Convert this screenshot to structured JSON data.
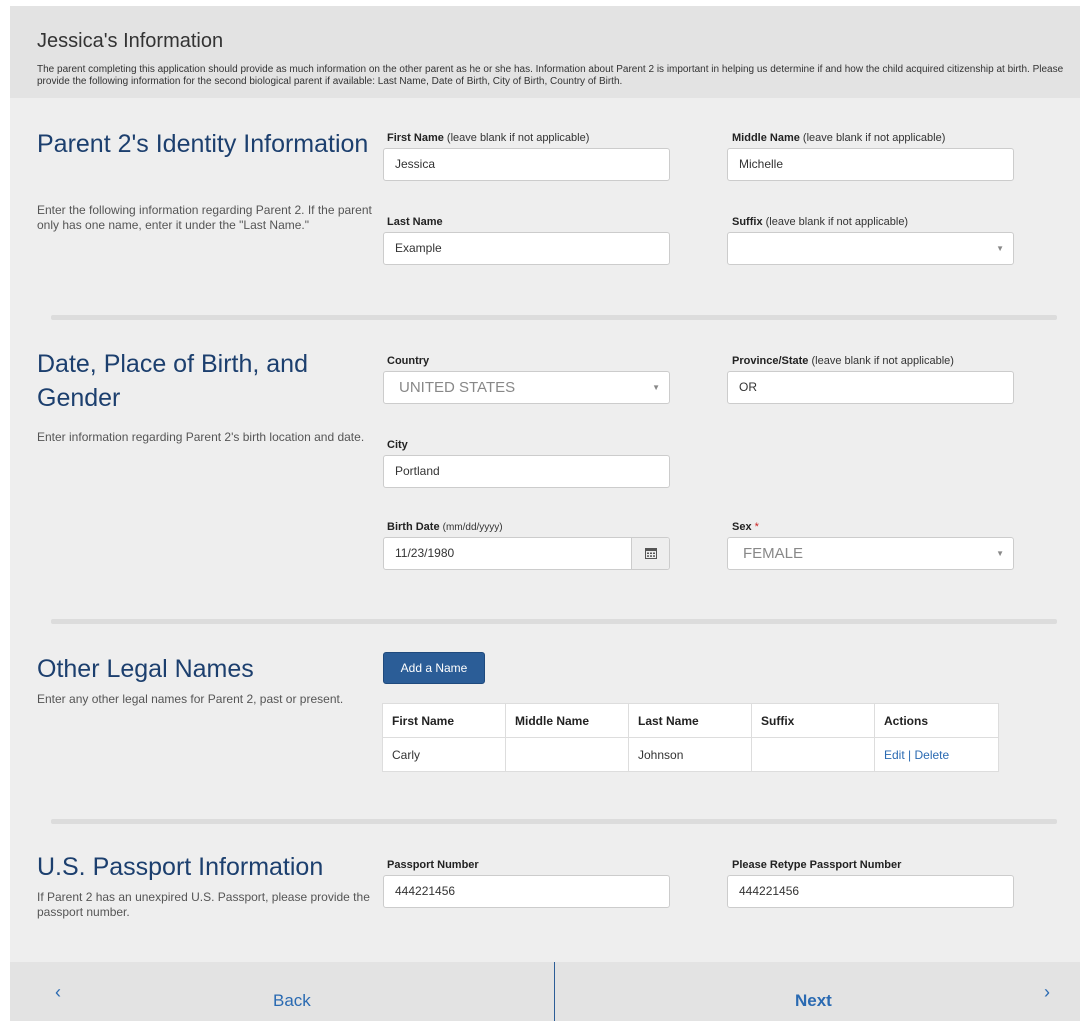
{
  "header": {
    "title": "Jessica's Information",
    "description": "The parent completing this application should provide as much information on the other parent as he or she has. Information about Parent 2 is important in helping us determine if and how the child acquired citizenship at birth. Please provide the following information for the second biological parent if available: Last Name, Date of Birth, City of Birth, Country of Birth."
  },
  "identity": {
    "title": "Parent 2's Identity Information",
    "description": "Enter the following information regarding Parent 2. If the parent only has one name, enter it under the \"Last Name.\"",
    "first_name": {
      "label": "First Name",
      "hint": "(leave blank if not applicable)",
      "value": "Jessica"
    },
    "middle_name": {
      "label": "Middle Name",
      "hint": "(leave blank if not applicable)",
      "value": "Michelle"
    },
    "last_name": {
      "label": "Last Name",
      "value": "Example"
    },
    "suffix": {
      "label": "Suffix",
      "hint": "(leave blank if not applicable)",
      "value": ""
    }
  },
  "birth": {
    "title": "Date, Place of Birth, and Gender",
    "description": "Enter information regarding Parent 2's birth location and date.",
    "country": {
      "label": "Country",
      "value": "UNITED STATES"
    },
    "province": {
      "label": "Province/State",
      "hint": "(leave blank if not applicable)",
      "value": "OR"
    },
    "city": {
      "label": "City",
      "value": "Portland"
    },
    "birth_date": {
      "label": "Birth Date",
      "hint": "(mm/dd/yyyy)",
      "value": "11/23/1980"
    },
    "sex": {
      "label": "Sex",
      "required_mark": "*",
      "value": "FEMALE"
    }
  },
  "other_names": {
    "title": "Other Legal Names",
    "description": "Enter any other legal names for Parent 2, past or present.",
    "add_button": "Add a Name",
    "columns": [
      "First Name",
      "Middle Name",
      "Last Name",
      "Suffix",
      "Actions"
    ],
    "rows": [
      {
        "first": "Carly",
        "middle": "",
        "last": "Johnson",
        "suffix": "",
        "edit": "Edit",
        "separator": "|",
        "delete": "Delete"
      }
    ]
  },
  "passport": {
    "title": "U.S. Passport Information",
    "description": "If Parent 2 has an unexpired U.S. Passport, please provide the passport number.",
    "number": {
      "label": "Passport Number",
      "value": "444221456"
    },
    "retype": {
      "label": "Please Retype Passport Number",
      "value": "444221456"
    }
  },
  "footer": {
    "back_label": "Back",
    "next_label": "Next",
    "back_icon": "chevron-left-icon",
    "next_icon": "chevron-right-icon"
  },
  "colors": {
    "accent": "#2b5d97",
    "section_title": "#1c3f6e",
    "link": "#2a6ab2",
    "required": "#cc2222"
  }
}
